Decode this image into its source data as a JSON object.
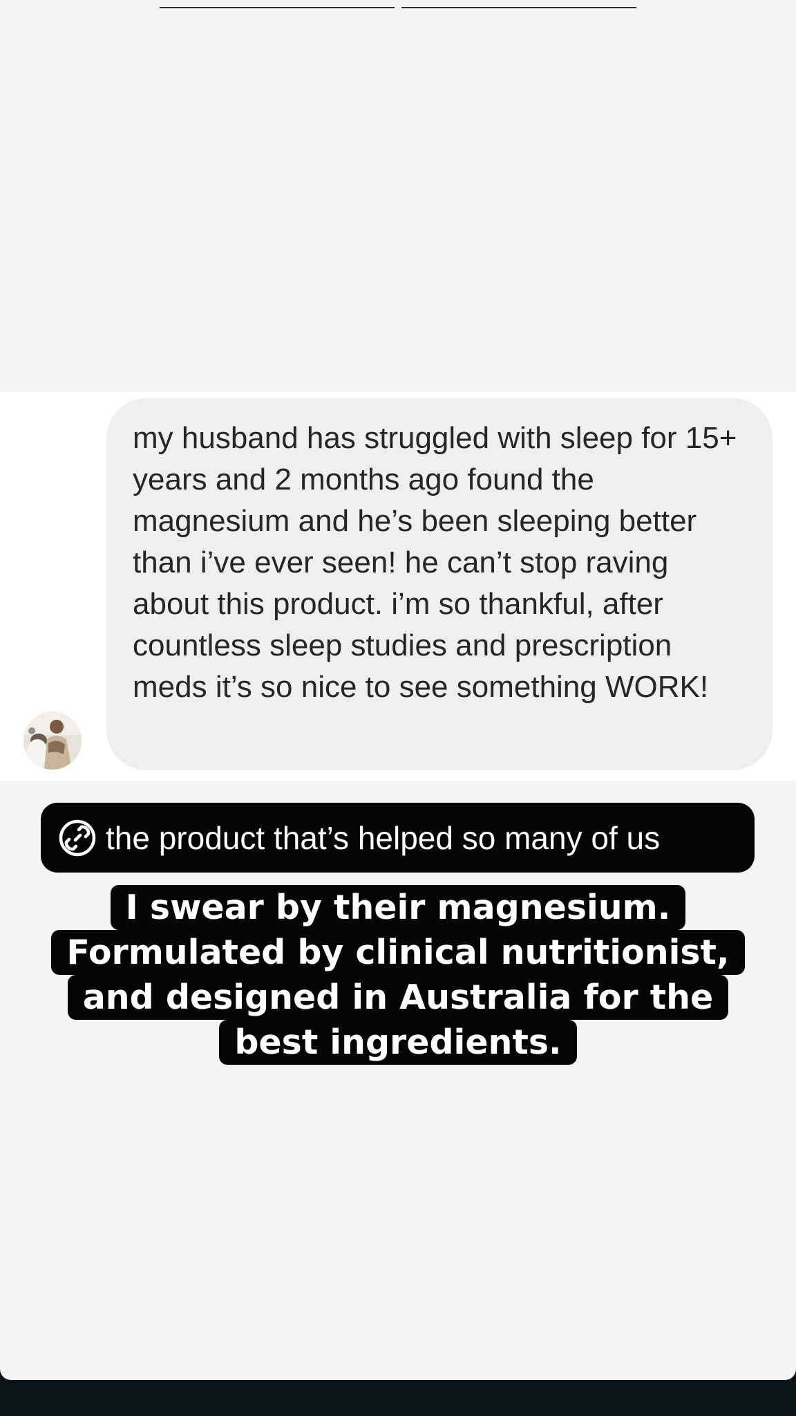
{
  "story": {
    "background": "#f4f4f4",
    "bottom_bar_color": "#0d1418"
  },
  "dm_message": {
    "text": "my husband has struggled with sleep for 15+ years and 2 months ago found the magnesium and he’s been sleeping better than i’ve ever seen! he can’t stop raving about this product. i’m so thankful, after countless sleep studies and prescription meds it’s so nice to see something WORK!",
    "avatar_icon": "profile-photo-avatar"
  },
  "link_sticker": {
    "icon": "link-icon",
    "label": "the product that’s helped so many of us"
  },
  "caption": {
    "lines": [
      "I swear by their magnesium.",
      "Formulated by clinical nutritionist,",
      "and designed in Australia for the",
      "best ingredients."
    ]
  }
}
